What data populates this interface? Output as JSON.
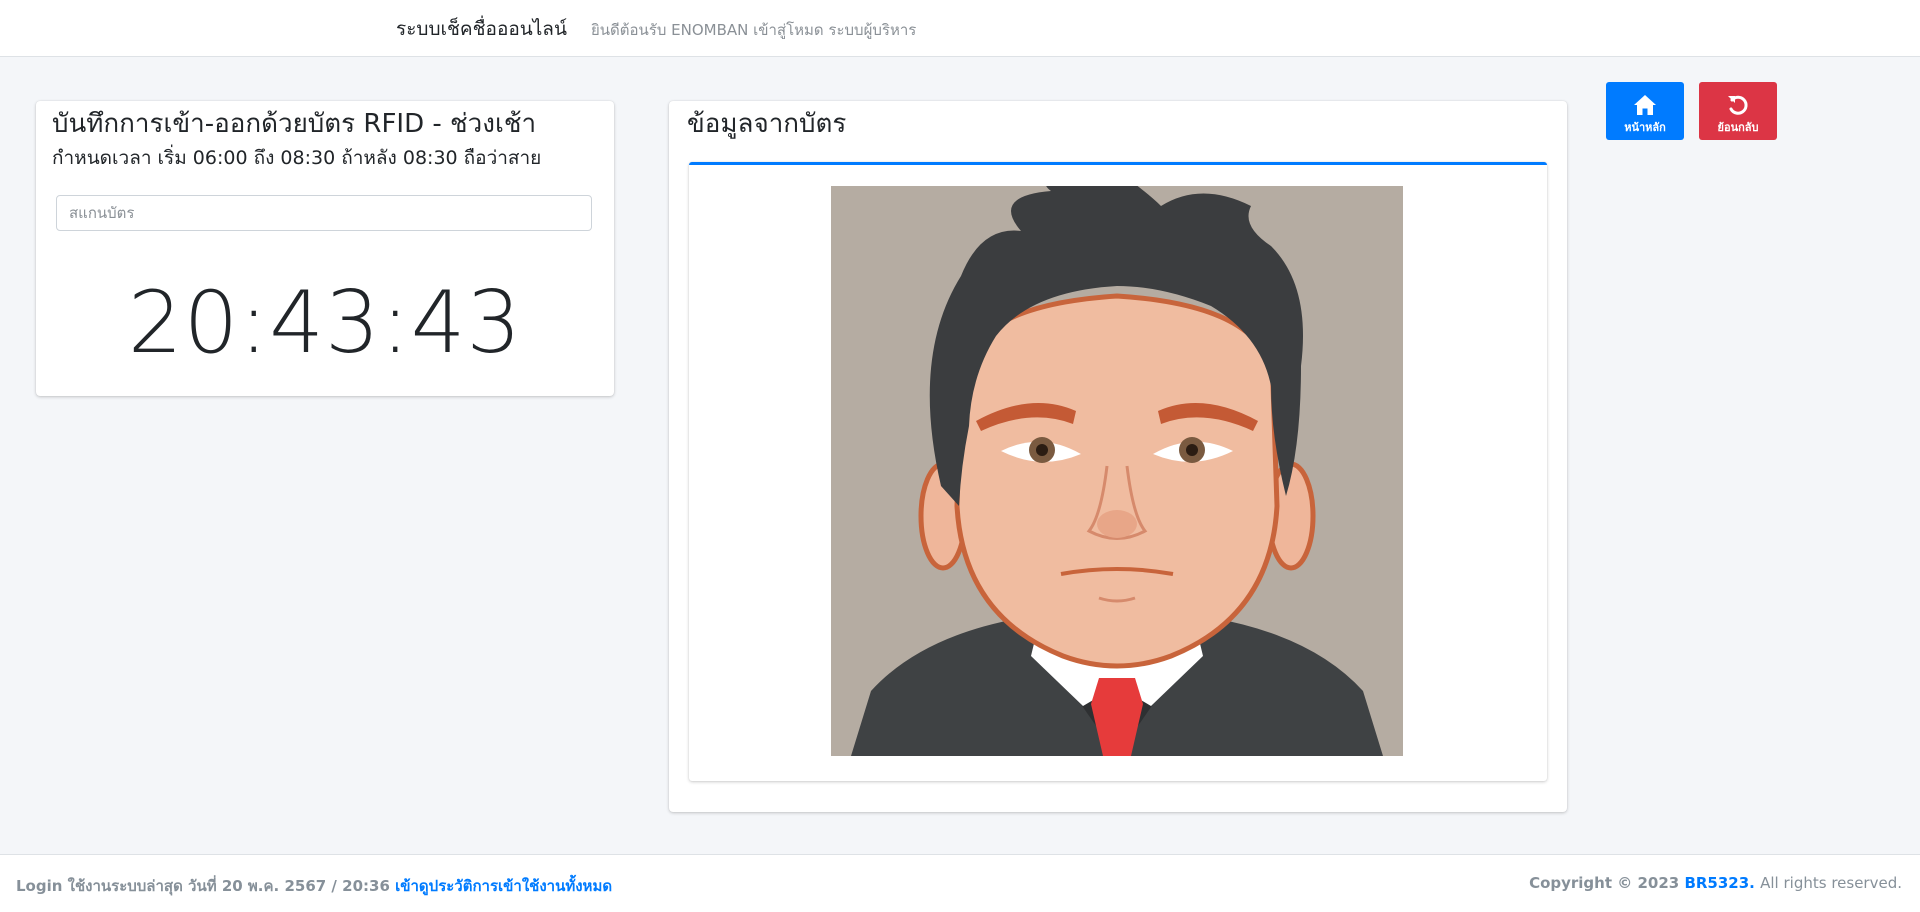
{
  "header": {
    "brand": "ระบบเช็คชื่อออนไลน์",
    "welcome": "ยินดีต้อนรับ ENOMBAN เข้าสู่โหมด ระบบผู้บริหาร"
  },
  "rfid_card": {
    "title": "บันทึกการเข้า-ออกด้วยบัตร RFID - ช่วงเช้า",
    "subtitle": "กำหนดเวลา เริ่ม 06:00 ถึง 08:30 ถ้าหลัง 08:30 ถือว่าสาย",
    "scan_placeholder": "สแกนบัตร",
    "clock": "20:43:43"
  },
  "info_card": {
    "title": "ข้อมูลจากบัตร",
    "photo_subject": "cartoon-avatar-man-in-suit"
  },
  "buttons": {
    "home_label": "หน้าหลัก",
    "home_icon": "home-icon",
    "back_label": "ย้อนกลับ",
    "back_icon": "undo-icon"
  },
  "footer": {
    "last_login_prefix": "Login ใช้งานระบบล่าสุด วันที่ 20 พ.ค. 2567 / 20:36",
    "history_link": "เข้าดูประวัติการเข้าใช้งานทั้งหมด",
    "copyright_prefix": "Copyright © 2023",
    "copyright_brand": "BR5323.",
    "rights": "All rights reserved."
  },
  "colors": {
    "primary": "#007bff",
    "danger": "#dc3545",
    "background": "#f4f6f9"
  }
}
